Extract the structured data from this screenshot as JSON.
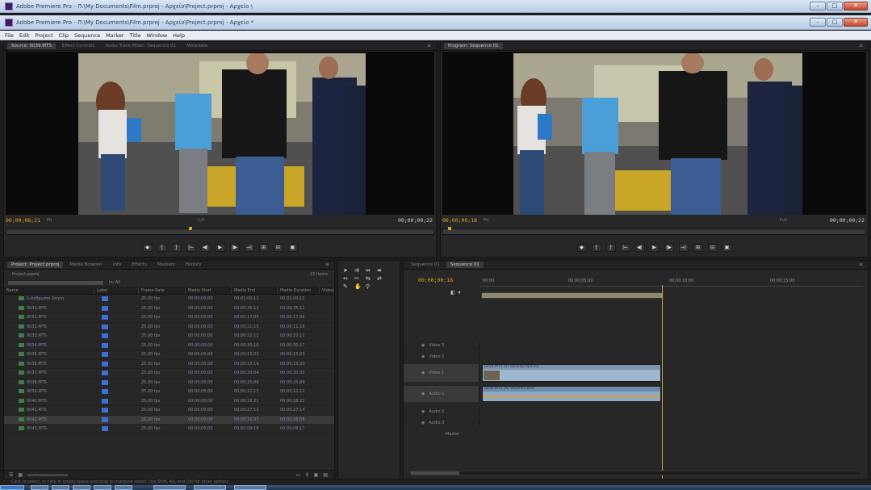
{
  "window": {
    "title_back": "Adobe Premiere Pro - Л:\\My Documents\\Film.prproj - Αρχείο\\Project.prproj - Αρχείο \\",
    "title_front": "Adobe Premiere Pro - Л:\\My Documents\\Film.prproj - Αρχείο\\Project.prproj - Αρχείο *",
    "btn_min": "–",
    "btn_max": "□",
    "btn_close": "✕"
  },
  "menu": [
    "File",
    "Edit",
    "Project",
    "Clip",
    "Sequence",
    "Marker",
    "Title",
    "Window",
    "Help"
  ],
  "source_monitor": {
    "tabs": [
      "Source: 0039.MTS",
      "Effect Controls",
      "Audio Track Mixer: Sequence 01",
      "Metadata"
    ],
    "timecode_left": "00;00;08;21",
    "fit": "Fit",
    "ratio": "1/2",
    "timecode_right": "00;00;00;22"
  },
  "program_monitor": {
    "tabs": [
      "Program: Sequence 01"
    ],
    "timecode_left": "00;00;00;18",
    "fit": "Fit",
    "ratio": "Full",
    "timecode_right": "00;00;00;22"
  },
  "transport": [
    "◆",
    "{",
    "}",
    "|←",
    "◀|",
    "▶",
    "|▶",
    "→|",
    "⊞",
    "⊟",
    "▣"
  ],
  "project": {
    "tabs": [
      "Project: Project.prproj",
      "Media Browser",
      "Info",
      "Effects",
      "Markers",
      "History"
    ],
    "project_name": "Project.prproj",
    "items_count": "15 Items",
    "in_label": "In: All",
    "columns": [
      "Name",
      "Label",
      "Frame Rate",
      "Media Start",
      "Media End",
      "Media Duration",
      "Video"
    ],
    "rows": [
      {
        "name": "1-Ανθρωποι Σκηνη",
        "rate": "25,00 fps",
        "start": "00;00;00;00",
        "end": "00;01;00;11",
        "dur": "00;01;00;12"
      },
      {
        "name": "0030.MTS",
        "rate": "25,00 fps",
        "start": "00;00;00;00",
        "end": "00;00;35;11",
        "dur": "00;00;35;12"
      },
      {
        "name": "0031.MTS",
        "rate": "25,00 fps",
        "start": "00;00;00;00",
        "end": "00;00;17;05",
        "dur": "00;00;17;06"
      },
      {
        "name": "0032.MTS",
        "rate": "25,00 fps",
        "start": "00;00;00;00",
        "end": "00;00;11;15",
        "dur": "00;00;11;16"
      },
      {
        "name": "0033.MTS",
        "rate": "25,00 fps",
        "start": "00;00;00;00",
        "end": "00;00;22;11",
        "dur": "00;00;22;12"
      },
      {
        "name": "0034.MTS",
        "rate": "25,00 fps",
        "start": "00;00;00;00",
        "end": "00;00;30;16",
        "dur": "00;00;30;17"
      },
      {
        "name": "0035.MTS",
        "rate": "25,00 fps",
        "start": "00;00;00;00",
        "end": "00;00;15;02",
        "dur": "00;00;15;03"
      },
      {
        "name": "0036.MTS",
        "rate": "25,00 fps",
        "start": "00;00;00;00",
        "end": "00;00;13;19",
        "dur": "00;00;13;20"
      },
      {
        "name": "0037.MTS",
        "rate": "25,00 fps",
        "start": "00;00;00;00",
        "end": "00;00;20;04",
        "dur": "00;00;20;05"
      },
      {
        "name": "0038.MTS",
        "rate": "25,00 fps",
        "start": "00;00;00;00",
        "end": "00;00;25;08",
        "dur": "00;00;25;09"
      },
      {
        "name": "0039.MTS",
        "rate": "25,00 fps",
        "start": "00;00;00;00",
        "end": "00;00;12;11",
        "dur": "00;00;12;12"
      },
      {
        "name": "0040.MTS",
        "rate": "25,00 fps",
        "start": "00;00;00;00",
        "end": "00;00;18;21",
        "dur": "00;00;18;22"
      },
      {
        "name": "0041.MTS",
        "rate": "25,00 fps",
        "start": "00;00;00;00",
        "end": "00;00;27;13",
        "dur": "00;00;27;14"
      },
      {
        "name": "0042.MTS",
        "rate": "25,00 fps",
        "start": "00;00;00;00",
        "end": "00;00;16;07",
        "dur": "00;00;16;08"
      },
      {
        "name": "0043.MTS",
        "rate": "25,00 fps",
        "start": "00;00;00;00",
        "end": "00;00;09;16",
        "dur": "00;00;09;17"
      }
    ]
  },
  "timeline": {
    "tabs": [
      "Sequence 01",
      "Sequence 01"
    ],
    "timecode": "00;00;00;18",
    "ruler": [
      "00;00",
      "00;00;05;00",
      "00;00;10;00",
      "00;00;15;00"
    ],
    "tracks": [
      "Video 3",
      "Video 2",
      "Video 1",
      "Audio 1",
      "Audio 2",
      "Audio 3"
    ],
    "master": "Master",
    "video_clip": "0039.MTS [V]  Opacity:Opacity",
    "audio_clip": "0039.MTS [A]  Volume:Level"
  },
  "status": "Click to select, or click in empty space and drag to marquee select. Use Shift, Alt, and Ctrl for other options."
}
